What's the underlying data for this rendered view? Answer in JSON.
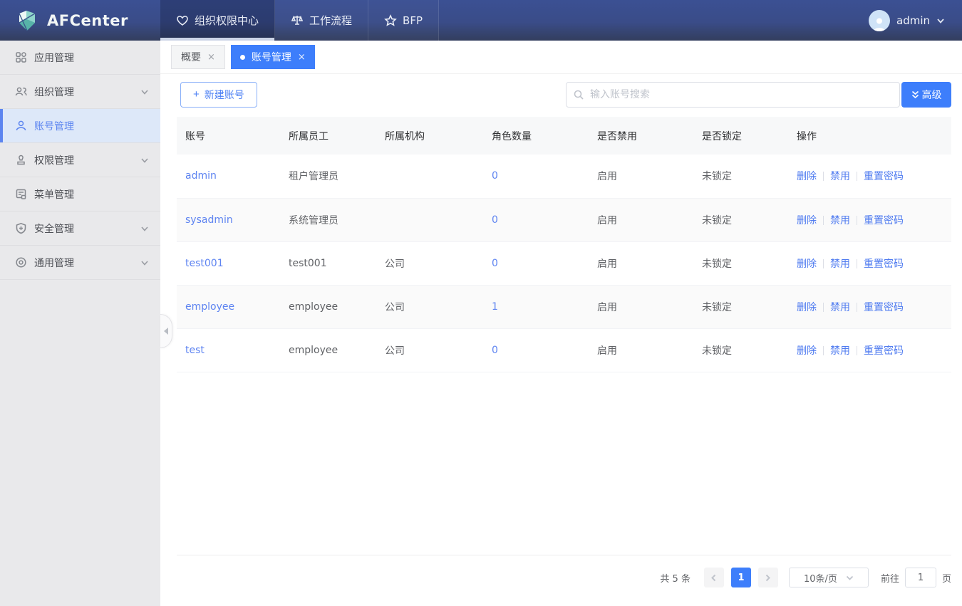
{
  "brand": {
    "name": "AFCenter"
  },
  "header": {
    "nav": [
      {
        "label": "组织权限中心",
        "icon": "heart-icon",
        "active": true
      },
      {
        "label": "工作流程",
        "icon": "scale-icon",
        "active": false
      },
      {
        "label": "BFP",
        "icon": "star-icon",
        "active": false
      }
    ],
    "user": {
      "name": "admin"
    }
  },
  "sidebar": {
    "items": [
      {
        "label": "应用管理",
        "icon": "grid-icon",
        "expandable": false,
        "active": false
      },
      {
        "label": "组织管理",
        "icon": "people-icon",
        "expandable": true,
        "active": false
      },
      {
        "label": "账号管理",
        "icon": "person-icon",
        "expandable": false,
        "active": true
      },
      {
        "label": "权限管理",
        "icon": "stamp-icon",
        "expandable": true,
        "active": false
      },
      {
        "label": "菜单管理",
        "icon": "document-icon",
        "expandable": false,
        "active": false
      },
      {
        "label": "安全管理",
        "icon": "shield-plus-icon",
        "expandable": true,
        "active": false
      },
      {
        "label": "通用管理",
        "icon": "target-icon",
        "expandable": true,
        "active": false
      }
    ]
  },
  "tabs": [
    {
      "label": "概要",
      "active": false,
      "close": "×"
    },
    {
      "label": "账号管理",
      "active": true,
      "close": "×"
    }
  ],
  "toolbar": {
    "new_account_label": "新建账号",
    "plus": "+",
    "search_placeholder": "输入账号搜索",
    "advanced_label": "高级"
  },
  "table": {
    "columns": [
      "账号",
      "所属员工",
      "所属机构",
      "角色数量",
      "是否禁用",
      "是否锁定",
      "操作"
    ],
    "actions": [
      "删除",
      "禁用",
      "重置密码"
    ],
    "rows": [
      {
        "account": "admin",
        "employee": "租户管理员",
        "org": "",
        "roles": "0",
        "disabled": "启用",
        "locked": "未锁定"
      },
      {
        "account": "sysadmin",
        "employee": "系统管理员",
        "org": "",
        "roles": "0",
        "disabled": "启用",
        "locked": "未锁定"
      },
      {
        "account": "test001",
        "employee": "test001",
        "org": "公司",
        "roles": "0",
        "disabled": "启用",
        "locked": "未锁定"
      },
      {
        "account": "employee",
        "employee": "employee",
        "org": "公司",
        "roles": "1",
        "disabled": "启用",
        "locked": "未锁定"
      },
      {
        "account": "test",
        "employee": "employee",
        "org": "公司",
        "roles": "0",
        "disabled": "启用",
        "locked": "未锁定"
      }
    ]
  },
  "pagination": {
    "total_label": "共 5 条",
    "current_page": "1",
    "page_size": "10条/页",
    "goto_label": "前往",
    "goto_value": "1",
    "page_label": "页"
  },
  "colors": {
    "accent_blue": "#3d7efb",
    "link_blue": "#5e84f1",
    "sidebar_active": "#5c85f0",
    "header_top": "#3b5093",
    "header_bottom": "#333e5e"
  }
}
